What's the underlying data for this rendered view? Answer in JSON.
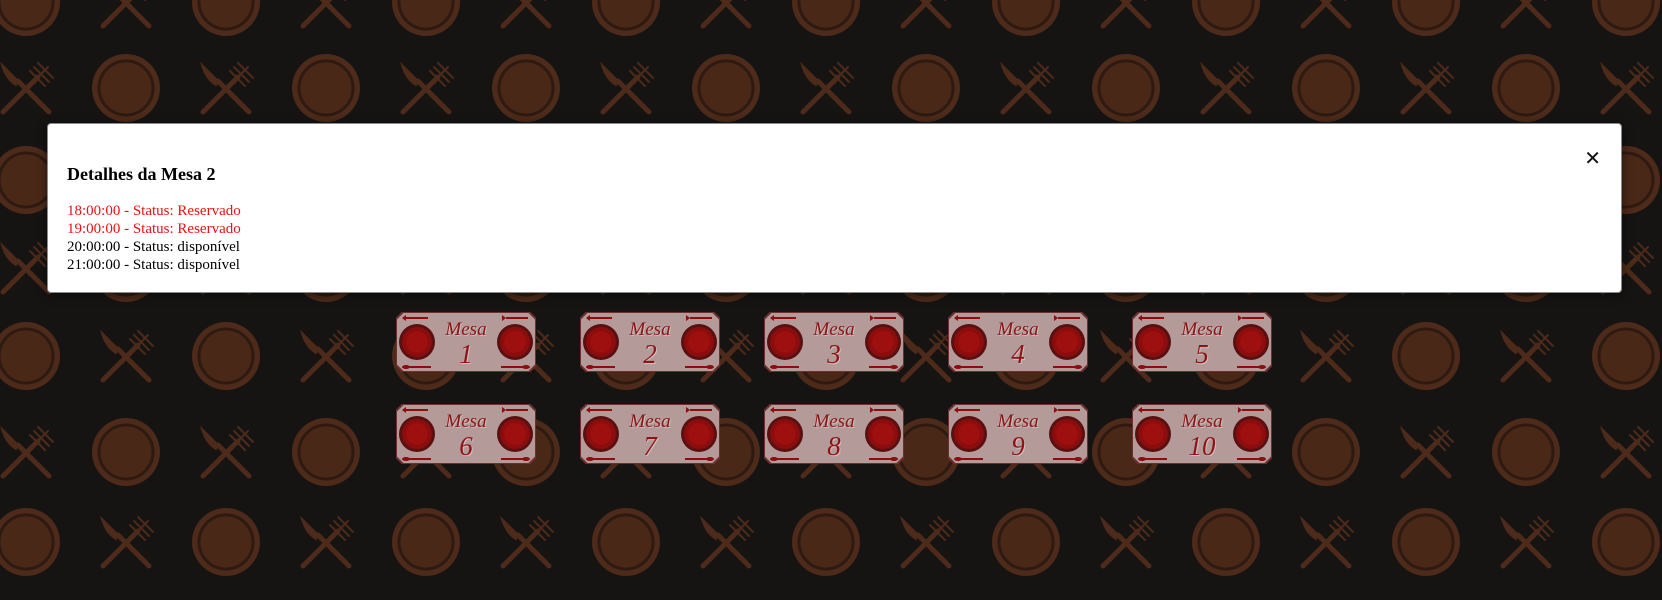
{
  "modal": {
    "title": "Detalhes da Mesa 2",
    "close_label": "✕",
    "slots": [
      {
        "text": "18:00:00 - Status: Reservado",
        "state": "reserved"
      },
      {
        "text": "19:00:00 - Status: Reservado",
        "state": "reserved"
      },
      {
        "text": "20:00:00 - Status: disponível",
        "state": "available"
      },
      {
        "text": "21:00:00 - Status: disponível",
        "state": "available"
      }
    ]
  },
  "tables": [
    {
      "word": "Mesa",
      "number": "1"
    },
    {
      "word": "Mesa",
      "number": "2"
    },
    {
      "word": "Mesa",
      "number": "3"
    },
    {
      "word": "Mesa",
      "number": "4"
    },
    {
      "word": "Mesa",
      "number": "5"
    },
    {
      "word": "Mesa",
      "number": "6"
    },
    {
      "word": "Mesa",
      "number": "7"
    },
    {
      "word": "Mesa",
      "number": "8"
    },
    {
      "word": "Mesa",
      "number": "9"
    },
    {
      "word": "Mesa",
      "number": "10"
    }
  ],
  "colors": {
    "background": "#151413",
    "pattern": "#4d2a19",
    "reserved_text": "#ee1111",
    "available_text": "#000000",
    "plate": "#8b0d0d",
    "card": "#b59a9a"
  },
  "icons": {
    "background_pattern": [
      "plate-icon",
      "crossed-cutlery-icon"
    ],
    "table_card": [
      "plate-icon",
      "knife-icon",
      "spoon-icon"
    ],
    "close": "close-icon"
  }
}
